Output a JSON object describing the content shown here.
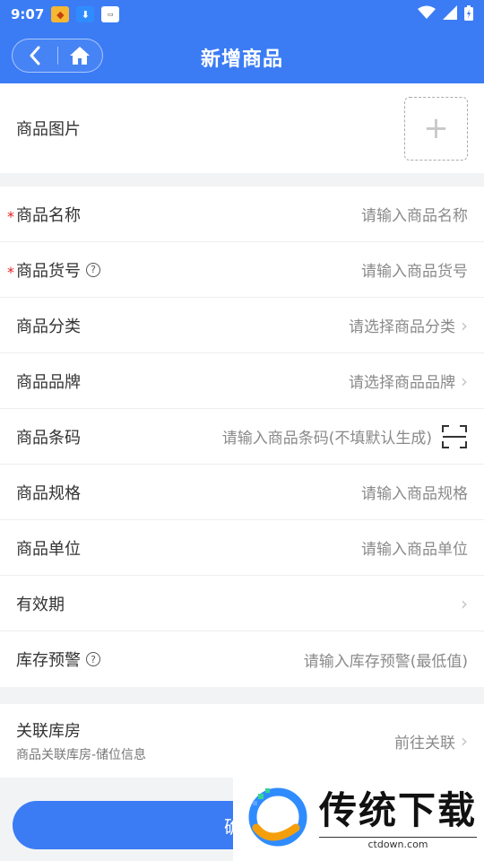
{
  "status_bar": {
    "time": "9:07"
  },
  "header": {
    "title": "新增商品"
  },
  "image_section": {
    "label": "商品图片",
    "upload_symbol": "+"
  },
  "fields": [
    {
      "label": "商品名称",
      "required": true,
      "help": false,
      "value": "请输入商品名称",
      "chevron": false,
      "scan": false
    },
    {
      "label": "商品货号",
      "required": true,
      "help": true,
      "value": "请输入商品货号",
      "chevron": false,
      "scan": false
    },
    {
      "label": "商品分类",
      "required": false,
      "help": false,
      "value": "请选择商品分类",
      "chevron": true,
      "scan": false
    },
    {
      "label": "商品品牌",
      "required": false,
      "help": false,
      "value": "请选择商品品牌",
      "chevron": true,
      "scan": false
    },
    {
      "label": "商品条码",
      "required": false,
      "help": false,
      "value": "请输入商品条码(不填默认生成)",
      "chevron": false,
      "scan": true
    },
    {
      "label": "商品规格",
      "required": false,
      "help": false,
      "value": "请输入商品规格",
      "chevron": false,
      "scan": false
    },
    {
      "label": "商品单位",
      "required": false,
      "help": false,
      "value": "请输入商品单位",
      "chevron": false,
      "scan": false
    },
    {
      "label": "有效期",
      "required": false,
      "help": false,
      "value": "",
      "chevron": true,
      "scan": false
    },
    {
      "label": "库存预警",
      "required": false,
      "help": true,
      "value": "请输入库存预警(最低值)",
      "chevron": false,
      "scan": false
    }
  ],
  "warehouse": {
    "title": "关联库房",
    "subtitle": "商品关联库房-储位信息",
    "action": "前往关联"
  },
  "confirm_button": {
    "label": "确认"
  },
  "watermark": {
    "title": "传统下载",
    "url": "ctdown.com"
  },
  "colors": {
    "primary": "#3b7cf5",
    "required": "#e02020"
  }
}
